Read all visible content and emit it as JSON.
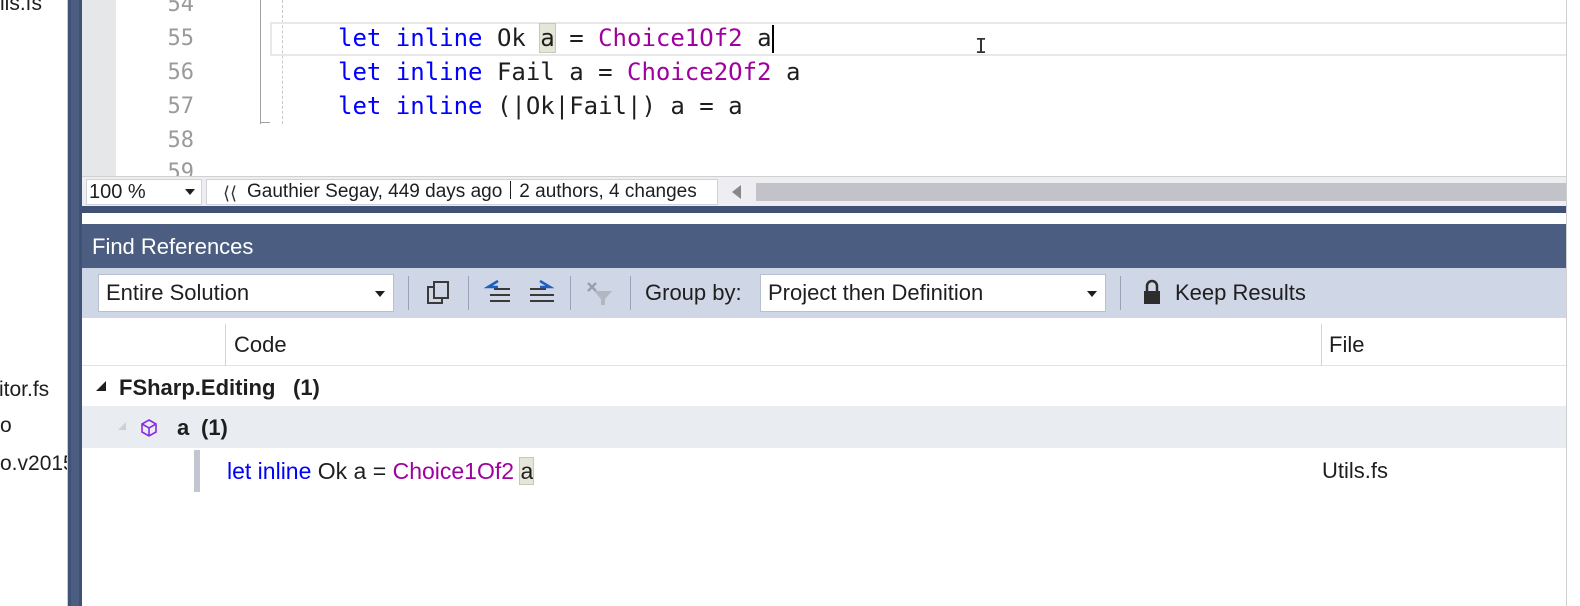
{
  "solution_explorer": {
    "items": [
      "ils.fs",
      "itor.fs",
      "o",
      "o.v2015"
    ]
  },
  "editor": {
    "line_numbers": [
      "54",
      "55",
      "56",
      "57",
      "58",
      "59"
    ],
    "lines": [
      {
        "kw": "let inline",
        "name": " Ok ",
        "hl": "a",
        "eq": " = ",
        "fn": "Choice1Of2",
        "arg_hl": "a"
      },
      {
        "kw": "let inline",
        "name": " Fail a = ",
        "fn": "Choice2Of2",
        "arg": " a"
      },
      {
        "kw": "let inline",
        "rest": " (|Ok|Fail|) a = a"
      }
    ]
  },
  "editor_bar": {
    "zoom": "100 %",
    "blame_author": "Gauthier Segay, 449 days ago",
    "blame_stats": "2 authors, 4 changes"
  },
  "find_references": {
    "title": "Find References",
    "scope": "Entire Solution",
    "group_by_label": "Group by:",
    "group_by_value": "Project then Definition",
    "keep_results": "Keep Results",
    "columns": {
      "code": "Code",
      "file": "File"
    },
    "project_group": "FSharp.Editing",
    "project_count": "(1)",
    "symbol_group": "a",
    "symbol_count": "(1)",
    "result": {
      "kw": "let inline",
      "text": " Ok a = ",
      "fn": "Choice1Of2",
      "hl": "a",
      "file": "Utils.fs"
    }
  },
  "colors": {
    "keyword": "#0000ff",
    "function": "#a000a0",
    "panel_title": "#4b5d80",
    "toolbar": "#cfd6e5"
  }
}
